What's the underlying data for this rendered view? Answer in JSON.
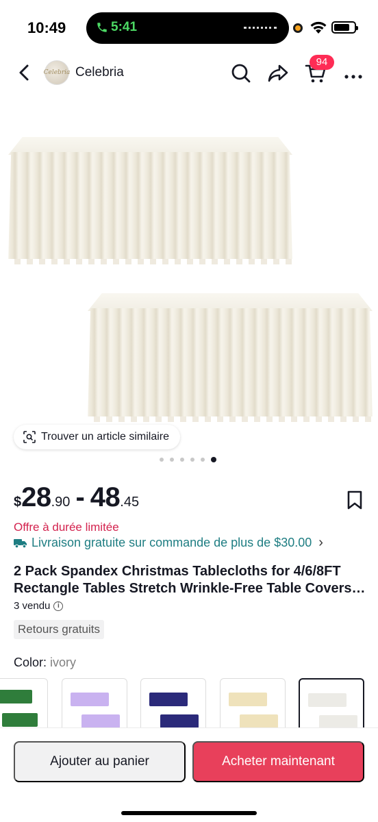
{
  "status_bar": {
    "time": "10:49",
    "call_time": "5:41",
    "battery_level": 0.8
  },
  "header": {
    "back_icon": "chevron-left-icon",
    "shop_name": "Celebria",
    "shop_logo_text": "Celebria",
    "cart_count": "94",
    "icons": [
      "search-icon",
      "share-icon",
      "cart-icon",
      "more-icon"
    ]
  },
  "gallery": {
    "find_similar_label": "Trouver un article similaire",
    "image_count": 6,
    "active_index": 5
  },
  "price": {
    "currency": "$",
    "min_int": "28",
    "min_dec": ".90",
    "separator": "-",
    "max_int": "48",
    "max_dec": ".45"
  },
  "promo": {
    "limited_offer": "Offre à durée limitée",
    "shipping": "Livraison gratuite sur commande de plus de $30.00"
  },
  "product": {
    "title_line1": "2 Pack Spandex Christmas Tablecloths for 4/6/8FT",
    "title_line2": "Rectangle Tables Stretch Wrinkle-Free Table Covers…",
    "sold": "3 vendu",
    "returns": "Retours gratuits"
  },
  "variants": {
    "label": "Color:",
    "selected": "ivory",
    "swatches": [
      {
        "color": "#2f7d3b"
      },
      {
        "color": "#c9b2f0"
      },
      {
        "color": "#2b2a7a"
      },
      {
        "color": "#efe2bb"
      },
      {
        "color": "#ecebe6"
      }
    ]
  },
  "actions": {
    "add_to_cart": "Ajouter au panier",
    "buy_now": "Acheter maintenant"
  },
  "colors": {
    "accent": "#fe2c55",
    "buy_button": "#e8405b",
    "limited": "#d3224e",
    "shipping": "#1e7d82"
  }
}
